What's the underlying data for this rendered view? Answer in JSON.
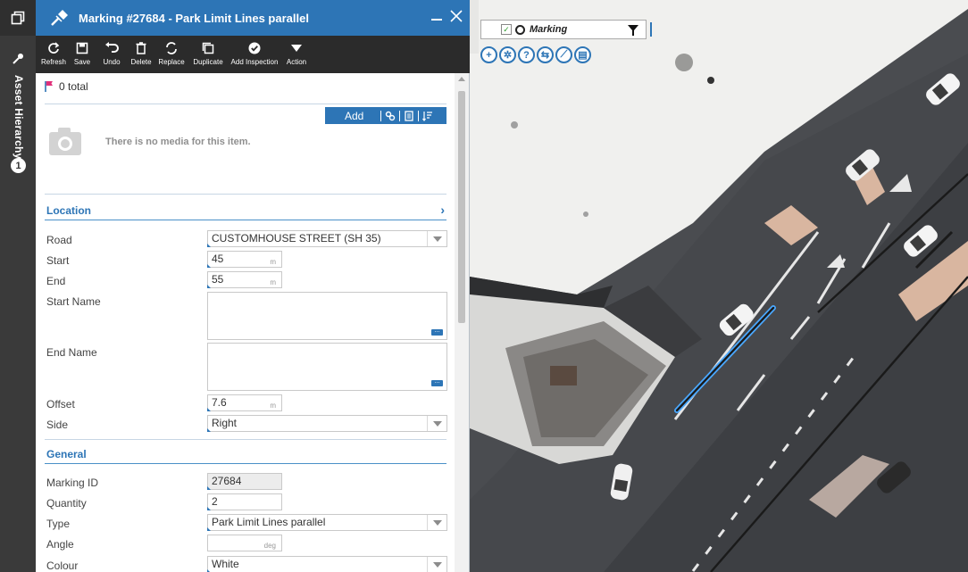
{
  "rail": {
    "vertical_label": "Asset Hierarchy",
    "count": "1"
  },
  "panel": {
    "title": "Marking #27684 - Park Limit Lines parallel",
    "toolbar": [
      {
        "label": "Refresh",
        "icon": "refresh-icon"
      },
      {
        "label": "Save",
        "icon": "save-icon"
      },
      {
        "label": "Undo",
        "icon": "undo-icon"
      },
      {
        "label": "Delete",
        "icon": "trash-icon"
      },
      {
        "label": "Replace",
        "icon": "replace-icon"
      },
      {
        "label": "Duplicate",
        "icon": "duplicate-icon"
      },
      {
        "label": "Add Inspection",
        "icon": "check-circle-icon"
      },
      {
        "label": "Action",
        "icon": "caret-down-icon"
      }
    ],
    "flags_total": "0 total",
    "media_add": "Add",
    "no_media_text": "There is no media for this item.",
    "sections": {
      "location": "Location",
      "general": "General"
    },
    "location": {
      "road_label": "Road",
      "road_value": "CUSTOMHOUSE STREET (SH 35)",
      "start_label": "Start",
      "start_value": "45",
      "start_unit": "m",
      "end_label": "End",
      "end_value": "55",
      "end_unit": "m",
      "start_name_label": "Start Name",
      "end_name_label": "End Name",
      "offset_label": "Offset",
      "offset_value": "7.6",
      "offset_unit": "m",
      "side_label": "Side",
      "side_value": "Right"
    },
    "general": {
      "marking_id_label": "Marking ID",
      "marking_id_value": "27684",
      "quantity_label": "Quantity",
      "quantity_value": "2",
      "type_label": "Type",
      "type_value": "Park Limit Lines parallel",
      "angle_label": "Angle",
      "angle_unit": "deg",
      "colour_label": "Colour",
      "colour_value": "White"
    }
  },
  "map": {
    "layer_name": "Marking",
    "tools": [
      "zoom-in-icon",
      "settings-icon",
      "help-icon",
      "layers-icon",
      "measure-icon",
      "print-icon"
    ]
  },
  "colors": {
    "titlebar": "#2d75b6",
    "toolbar": "#2b2b2b",
    "rail": "#3a3a3a",
    "accent": "#2d75b6"
  }
}
